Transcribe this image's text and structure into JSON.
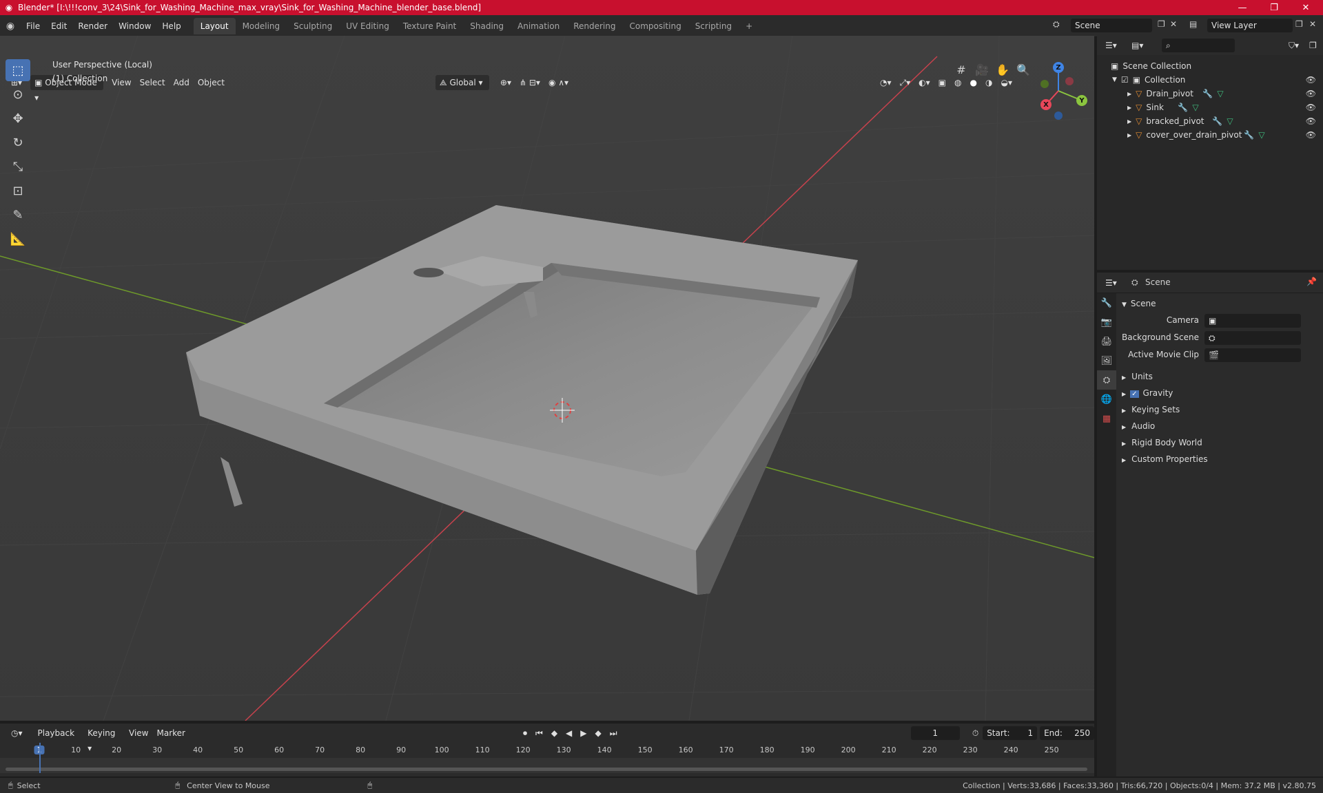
{
  "window": {
    "title": "Blender* [I:\\!!!conv_3\\24\\Sink_for_Washing_Machine_max_vray\\Sink_for_Washing_Machine_blender_base.blend]",
    "minimize": "—",
    "maximize": "❐",
    "close": "✕"
  },
  "menu": {
    "items": [
      "File",
      "Edit",
      "Render",
      "Window",
      "Help"
    ]
  },
  "workspaces": {
    "tabs": [
      "Layout",
      "Modeling",
      "Sculpting",
      "UV Editing",
      "Texture Paint",
      "Shading",
      "Animation",
      "Rendering",
      "Compositing",
      "Scripting"
    ],
    "add": "+"
  },
  "scene_selector": {
    "value": "Scene"
  },
  "view_layer": {
    "value": "View Layer"
  },
  "viewport": {
    "mode": "Object Mode",
    "menu": [
      "View",
      "Select",
      "Add",
      "Object"
    ],
    "transform": "Global",
    "info_line1": "User Perspective (Local)",
    "info_line2": "(1) Collection"
  },
  "gizmo": {
    "x": "X",
    "y": "Y",
    "z": "Z"
  },
  "outliner": {
    "search_placeholder": "",
    "root": "Scene Collection",
    "collection": "Collection",
    "objects": [
      "Drain_pivot",
      "Sink",
      "bracked_pivot",
      "cover_over_drain_pivot"
    ]
  },
  "properties": {
    "header": "Scene",
    "panel": "Scene",
    "camera_label": "Camera",
    "background_label": "Background Scene",
    "clip_label": "Active Movie Clip",
    "sections": [
      "Units",
      "Gravity",
      "Keying Sets",
      "Audio",
      "Rigid Body World",
      "Custom Properties"
    ]
  },
  "timeline": {
    "menu": [
      "Playback",
      "Keying",
      "View",
      "Marker"
    ],
    "current_frame": "1",
    "start_label": "Start:",
    "start": "1",
    "end_label": "End:",
    "end": "250",
    "ticks": [
      "1",
      "10",
      "20",
      "30",
      "40",
      "50",
      "60",
      "70",
      "80",
      "90",
      "100",
      "110",
      "120",
      "130",
      "140",
      "150",
      "160",
      "170",
      "180",
      "190",
      "200",
      "210",
      "220",
      "230",
      "240",
      "250"
    ]
  },
  "status": {
    "select": "Select",
    "center": "Center View to Mouse",
    "stats": "Collection | Verts:33,686 | Faces:33,360 | Tris:66,720 | Objects:0/4 | Mem: 37.2 MB | v2.80.75"
  },
  "colors": {
    "accent": "#4772b3",
    "title_bar": "#c8102e",
    "x_axis": "#e8475a",
    "y_axis": "#8bc53f",
    "z_axis": "#3f84e5"
  }
}
